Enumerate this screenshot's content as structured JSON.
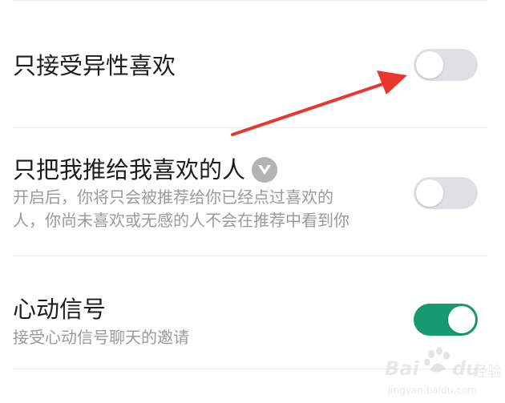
{
  "settings": {
    "opposite_sex": {
      "title": "只接受异性喜欢",
      "enabled": false
    },
    "push_to_liked": {
      "title": "只把我推给我喜欢的人",
      "badge_icon": "v-vip-icon",
      "desc_line1": "开启后，你将只会被推荐给你已经点过喜欢的",
      "desc_line2": "人，你尚未喜欢或无感的人不会在推荐中看到你",
      "enabled": false
    },
    "heart_signal": {
      "title": "心动信号",
      "desc": "接受心动信号聊天的邀请",
      "enabled": true
    }
  },
  "annotation": {
    "arrow_color": "#e8372f"
  },
  "watermark": {
    "brand": "Bai",
    "brand2": "du",
    "label": "经验",
    "url": "jingyan.baidu.com"
  },
  "colors": {
    "toggle_on": "#169a6f",
    "toggle_off": "#e0e0e4",
    "desc_text": "#9a9a9a"
  }
}
